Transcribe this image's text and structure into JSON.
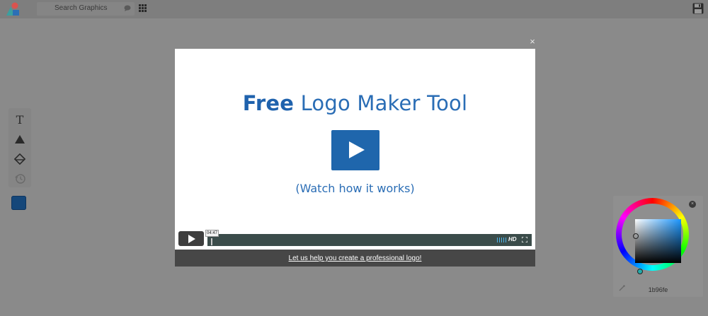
{
  "toolbar": {
    "search_placeholder": "Search Graphics"
  },
  "tools": {
    "text_tool": "T"
  },
  "modal": {
    "close_label": "×",
    "title_bold": "Free",
    "title_rest": " Logo Maker Tool",
    "subtitle": "(Watch how it works)",
    "time": "04:47",
    "hd_label": "HD",
    "footer_link": "Let us help you create a professional logo!"
  },
  "color_picker": {
    "hex_value": "1b96fe",
    "close_label": "×"
  },
  "colors": {
    "accent": "#1b96fe",
    "title_blue": "#2a6db5",
    "play_button": "#1f66ac",
    "selected_swatch": "#15477a"
  }
}
